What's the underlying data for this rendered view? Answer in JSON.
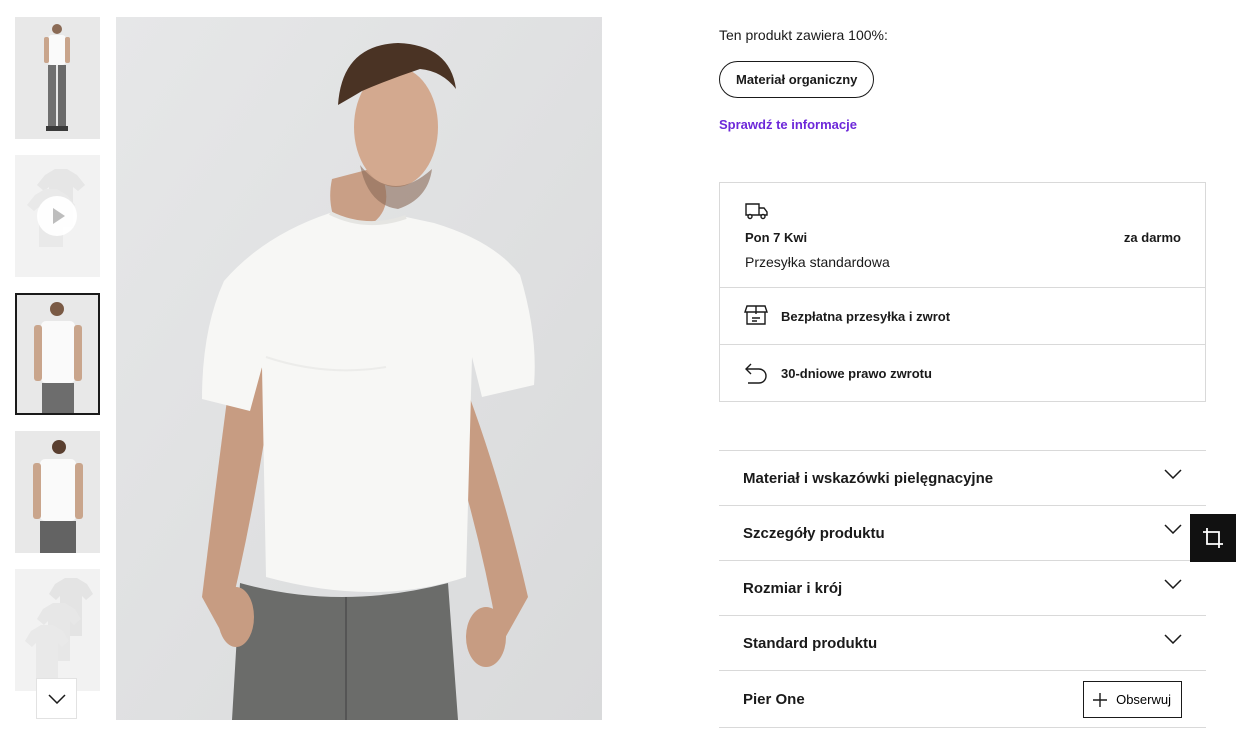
{
  "gallery": {
    "thumbnails": [
      {
        "kind": "photo",
        "pose": "full-body"
      },
      {
        "kind": "video"
      },
      {
        "kind": "photo",
        "pose": "front",
        "selected": true
      },
      {
        "kind": "photo",
        "pose": "back"
      },
      {
        "kind": "photo",
        "pose": "pack"
      }
    ],
    "scroll_icon": "chevron-down-icon"
  },
  "product": {
    "composition_text": "Ten produkt zawiera 100%:",
    "material_pill": "Materiał organiczny",
    "check_link": "Sprawdź te informacje"
  },
  "delivery": {
    "date": "Pon 7 Kwi",
    "price": "za darmo",
    "method": "Przesyłka standardowa",
    "free_shipping": "Bezpłatna przesyłka i zwrot",
    "returns": "30-dniowe prawo zwrotu"
  },
  "accordion": [
    {
      "title": "Materiał i wskazówki pielęgnacyjne"
    },
    {
      "title": "Szczegóły produktu"
    },
    {
      "title": "Rozmiar i krój"
    },
    {
      "title": "Standard produktu"
    }
  ],
  "brand": {
    "name": "Pier One",
    "follow_label": "Obserwuj"
  },
  "colors": {
    "accent_link": "#6d28d9",
    "text": "#1a1a1a",
    "border": "#d9d9d9"
  }
}
